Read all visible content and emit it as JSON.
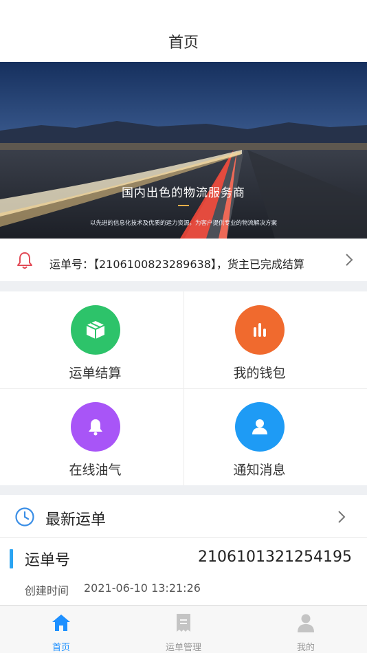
{
  "header": {
    "title": "首页"
  },
  "banner": {
    "headline": "国内出色的物流服务商",
    "subline": "以先进的信息化技术及优质的运力资源，为客户提供专业的物流解决方案"
  },
  "notice": {
    "icon": "bell-icon",
    "text": "运单号：【2106100823289638】，货主已完成结算"
  },
  "grid": {
    "items": [
      {
        "label": "运单结算",
        "icon": "box-icon",
        "color": "#2dc36a"
      },
      {
        "label": "我的钱包",
        "icon": "bar-chart-icon",
        "color": "#f06a2e"
      },
      {
        "label": "在线油气",
        "icon": "bell-icon",
        "color": "#a855f7"
      },
      {
        "label": "通知消息",
        "icon": "user-icon",
        "color": "#1e9bf5"
      }
    ]
  },
  "latest": {
    "title": "最新运单",
    "icon": "clock-icon"
  },
  "order": {
    "label": "运单号",
    "number": "2106101321254195",
    "time_label": "创建时间",
    "time": "2021-06-10 13:21:26"
  },
  "tabbar": {
    "items": [
      {
        "label": "首页",
        "icon": "home-icon",
        "active": true
      },
      {
        "label": "运单管理",
        "icon": "receipt-icon",
        "active": false
      },
      {
        "label": "我的",
        "icon": "person-icon",
        "active": false
      }
    ]
  },
  "colors": {
    "accent": "#1e90ff",
    "indicator": "#2aa4f2",
    "notice_bell": "#e24b57"
  }
}
